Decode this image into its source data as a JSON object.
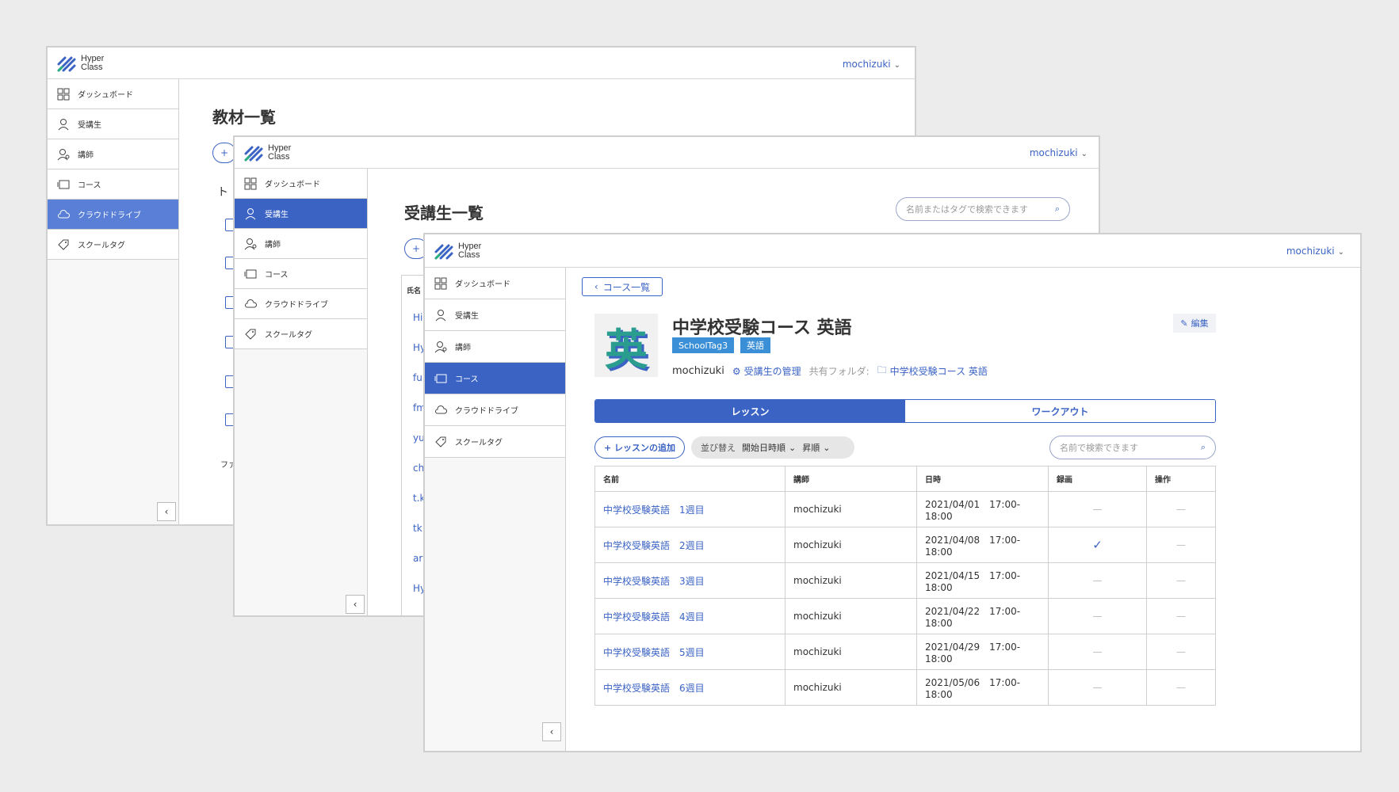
{
  "brand": {
    "line1": "Hyper",
    "line2": "Class"
  },
  "user": {
    "name": "mochizuki"
  },
  "nav": {
    "dashboard": "ダッシュボード",
    "students": "受講生",
    "teachers": "講師",
    "courses": "コース",
    "cloud": "クラウドドライブ",
    "tags": "スクールタグ"
  },
  "win1": {
    "title": "教材一覧",
    "add_label": "+",
    "fragment_to": "ト",
    "fragment_fa": "ファ"
  },
  "win2": {
    "title": "受講生一覧",
    "search_placeholder": "名前またはタグで検索できます",
    "add_label": "+",
    "col_name": "氏名",
    "rows": [
      "Hi",
      "Hy",
      "fu",
      "fm",
      "yu",
      "ch",
      "t.k",
      "tk",
      "ar",
      "Hy"
    ]
  },
  "course": {
    "back_label": "コース一覧",
    "thumb_char": "英",
    "title": "中学校受験コース 英語",
    "tags": [
      "SchoolTag3",
      "英語"
    ],
    "owner": "mochizuki",
    "manage_students": "受講生の管理",
    "shared_folder_label": "共有フォルダ:",
    "folder_name": "中学校受験コース 英語",
    "edit_label": "編集",
    "tabs": [
      "レッスン",
      "ワークアウト"
    ],
    "add_lesson": "+ レッスンの追加",
    "sort_label": "並び替え",
    "sort_field": "開始日時順",
    "sort_order": "昇順",
    "search_placeholder": "名前で検索できます",
    "columns": [
      "名前",
      "講師",
      "日時",
      "録画",
      "操作"
    ],
    "lessons": [
      {
        "name": "中学校受験英語　1週目",
        "teacher": "mochizuki",
        "datetime": "2021/04/01　17:00-18:00",
        "recording": "—",
        "ops": "—"
      },
      {
        "name": "中学校受験英語　2週目",
        "teacher": "mochizuki",
        "datetime": "2021/04/08　17:00-18:00",
        "recording": "✓",
        "ops": "—"
      },
      {
        "name": "中学校受験英語　3週目",
        "teacher": "mochizuki",
        "datetime": "2021/04/15　17:00-18:00",
        "recording": "—",
        "ops": "—"
      },
      {
        "name": "中学校受験英語　4週目",
        "teacher": "mochizuki",
        "datetime": "2021/04/22　17:00-18:00",
        "recording": "—",
        "ops": "—"
      },
      {
        "name": "中学校受験英語　5週目",
        "teacher": "mochizuki",
        "datetime": "2021/04/29　17:00-18:00",
        "recording": "—",
        "ops": "—"
      },
      {
        "name": "中学校受験英語　6週目",
        "teacher": "mochizuki",
        "datetime": "2021/05/06　17:00-18:00",
        "recording": "—",
        "ops": "—"
      }
    ]
  },
  "colors": {
    "accent": "#3b63c4",
    "tag": "#3b8fd6",
    "sidebar_active_light": "#5a7fd6"
  }
}
